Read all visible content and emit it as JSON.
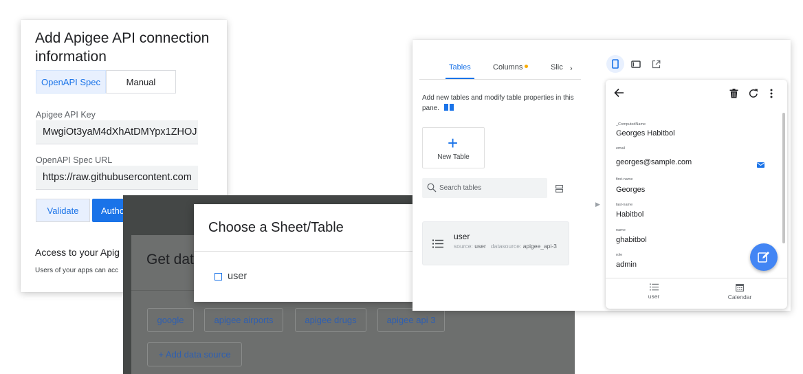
{
  "apigee_panel": {
    "title": "Add Apigee API connection information",
    "segments": {
      "openapi_label": "OpenAPI Spec",
      "manual_label": "Manual"
    },
    "api_key": {
      "label": "Apigee API Key",
      "value": "MwgiOt3yaM4dXhAtDMYpx1ZHOJ"
    },
    "spec_url": {
      "label": "OpenAPI Spec URL",
      "value": "https://raw.githubusercontent.com"
    },
    "validate_label": "Validate",
    "authorize_label": "Autho",
    "access_title": "Access to your Apig",
    "access_desc": "Users of your apps can acc"
  },
  "datasource_panel": {
    "title": "Get dat",
    "chips": [
      "google",
      "apigee airports",
      "apigee drugs",
      "apigee api 3"
    ],
    "add_label": "+ Add data source"
  },
  "sheet_dialog": {
    "title": "Choose a Sheet/Table",
    "option_label": "user"
  },
  "tables_panel": {
    "tabs": {
      "tables": "Tables",
      "columns": "Columns",
      "slices": "Slic"
    },
    "tab_overflow": "›",
    "description": "Add new tables and modify table properties in this pane.",
    "new_table_label": "New Table",
    "new_table_plus": "+",
    "search_placeholder": "Search tables",
    "table_card": {
      "name": "user",
      "source_label": "source:",
      "source_value": "user",
      "datasource_label": "datasource:",
      "datasource_value": "apigee_api-3"
    },
    "collapse_arrow": "▶",
    "accent_color": "#1a73e8",
    "columns_badge_color": "#f9ab00"
  },
  "phone_preview": {
    "fields": [
      {
        "label": "_ComputedName",
        "value": "Georges Habitbol"
      },
      {
        "label": "email",
        "value": "georges@sample.com"
      },
      {
        "label": "first-name",
        "value": "Georges"
      },
      {
        "label": "last-name",
        "value": "Habitbol"
      },
      {
        "label": "name",
        "value": "ghabitbol"
      },
      {
        "label": "role",
        "value": "admin"
      }
    ],
    "nav": {
      "user_label": "user",
      "calendar_label": "Calendar"
    },
    "icons": [
      "back-arrow-icon",
      "delete-icon",
      "refresh-icon",
      "more-vert-icon",
      "email-icon",
      "edit-icon",
      "list-icon",
      "calendar-icon"
    ]
  }
}
